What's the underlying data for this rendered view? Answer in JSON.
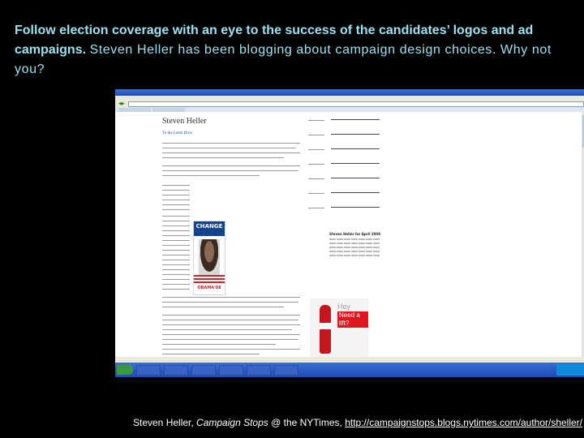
{
  "caption": {
    "bold": "Follow election coverage with an eye to the success of the candidates’ logos and ad campaigns.",
    "rest": "Steven Heller has been blogging about campaign design choices. Why not you?"
  },
  "credit": {
    "prefix": "Steven Heller, ",
    "italic": "Campaign Stops",
    "middle": " @ the NYTimes, ",
    "url": "http://campaignstops.blogs.nytimes.com/author/sheller/"
  },
  "screenshot": {
    "blog_title": "Steven Heller",
    "post_title": "To the Letter Born",
    "poster_top": "CHANGE",
    "poster_name": "OBAMA'08",
    "calendar_title": "Steven Heller for April 2008",
    "ad": {
      "hey": "Hey there.",
      "lift": "Need a lift?"
    }
  }
}
